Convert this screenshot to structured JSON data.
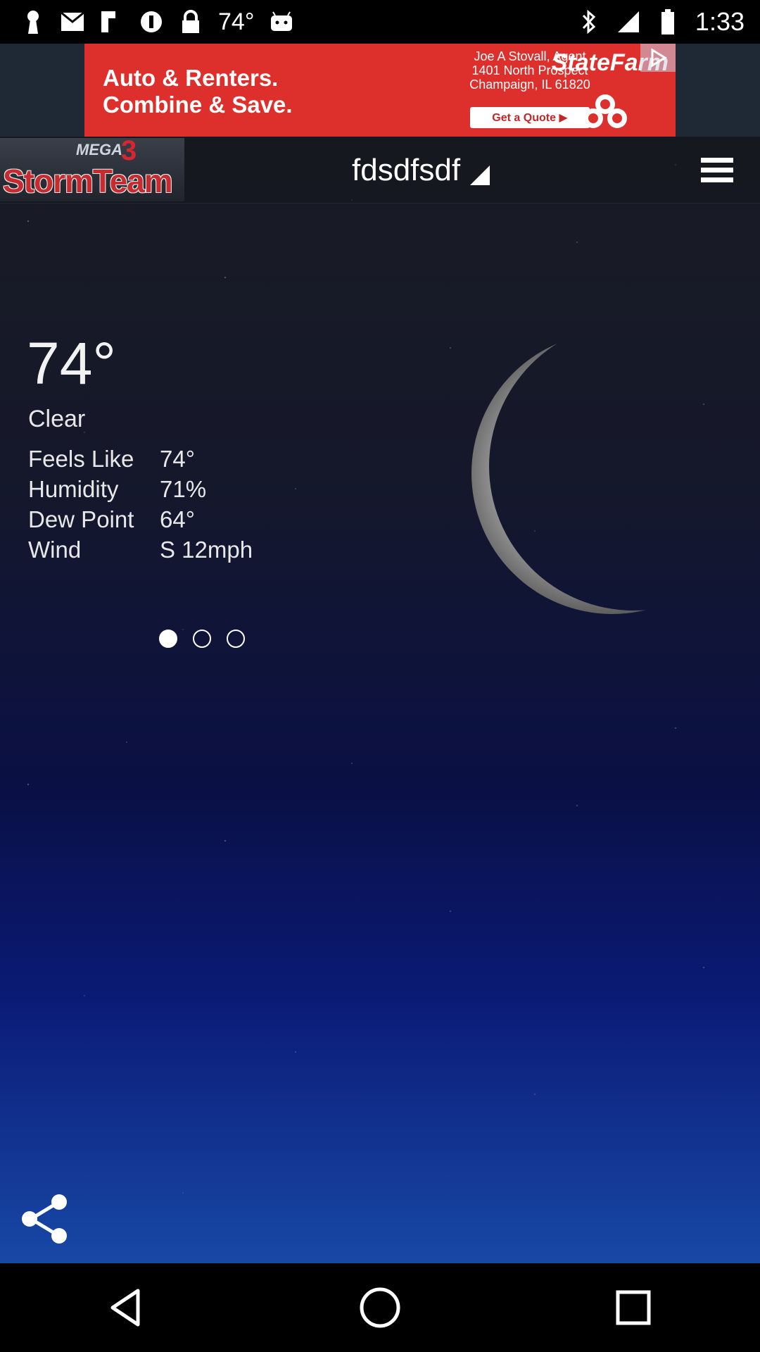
{
  "status_bar": {
    "temperature": "74°",
    "time": "1:33",
    "icons": [
      "keyhole-icon",
      "mail-icon",
      "flipboard-icon",
      "info-icon",
      "lock-icon",
      "android-icon",
      "bluetooth-icon",
      "signal-icon",
      "battery-icon"
    ]
  },
  "ad": {
    "headline": "Auto & Renters.\nCombine & Save.",
    "agent": "Joe A Stovall, Agent\n1401 North Prospect\nChampaign, IL 61820",
    "cta": "Get a Quote ▶",
    "brand": "StateFarm"
  },
  "header": {
    "logo_small": "MEGA",
    "logo_number": "3",
    "logo_text": "StormTeam",
    "location": "fdsdfsdf"
  },
  "weather": {
    "temperature": "74°",
    "condition": "Clear",
    "details": [
      {
        "label": "Feels Like",
        "value": "74°"
      },
      {
        "label": "Humidity",
        "value": "71%"
      },
      {
        "label": "Dew Point",
        "value": "64°"
      },
      {
        "label": "Wind",
        "value": "S 12mph"
      }
    ]
  },
  "pager": {
    "count": 3,
    "active_index": 0
  }
}
